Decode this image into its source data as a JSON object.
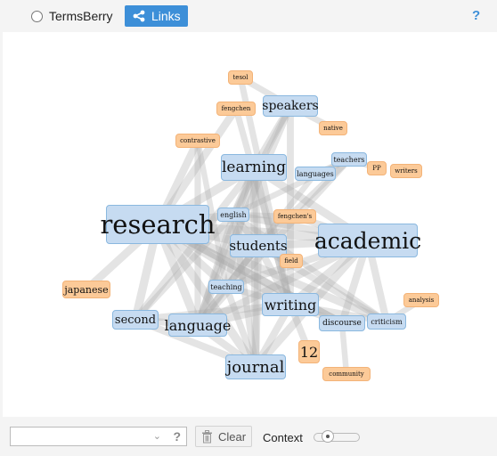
{
  "topbar": {
    "radio_label": "TermsBerry",
    "links_label": "Links",
    "help": "?"
  },
  "graph": {
    "colors": {
      "main_fill": "#c6dbf1",
      "context_fill": "#fcca98",
      "edge": "#aaaaaa"
    },
    "nodes": [
      {
        "id": "research",
        "label": "research",
        "type": "main",
        "weight": 1.0
      },
      {
        "id": "academic",
        "label": "academic",
        "type": "main",
        "weight": 0.8
      },
      {
        "id": "learning",
        "label": "learning",
        "type": "main",
        "weight": 0.55
      },
      {
        "id": "writing",
        "label": "writing",
        "type": "main",
        "weight": 0.5
      },
      {
        "id": "journal",
        "label": "journal",
        "type": "main",
        "weight": 0.55
      },
      {
        "id": "language",
        "label": "language",
        "type": "main",
        "weight": 0.5
      },
      {
        "id": "students",
        "label": "students",
        "type": "main",
        "weight": 0.5
      },
      {
        "id": "speakers",
        "label": "speakers",
        "type": "main",
        "weight": 0.45
      },
      {
        "id": "second",
        "label": "second",
        "type": "main",
        "weight": 0.45
      },
      {
        "id": "discourse",
        "label": "discourse",
        "type": "main",
        "weight": 0.3
      },
      {
        "id": "criticism",
        "label": "criticism",
        "type": "main",
        "weight": 0.25
      },
      {
        "id": "languages",
        "label": "languages",
        "type": "main",
        "weight": 0.25
      },
      {
        "id": "teachers",
        "label": "teachers",
        "type": "main",
        "weight": 0.25
      },
      {
        "id": "teaching",
        "label": "teaching",
        "type": "main",
        "weight": 0.25
      },
      {
        "id": "english",
        "label": "english",
        "type": "main",
        "weight": 0.25
      },
      {
        "id": "tesol",
        "label": "tesol",
        "type": "context",
        "weight": 0.2
      },
      {
        "id": "fengchen",
        "label": "fengchen",
        "type": "context",
        "weight": 0.2
      },
      {
        "id": "native",
        "label": "native",
        "type": "context",
        "weight": 0.2
      },
      {
        "id": "contrastive",
        "label": "contrastive",
        "type": "context",
        "weight": 0.2
      },
      {
        "id": "pp",
        "label": "PP",
        "type": "context",
        "weight": 0.2
      },
      {
        "id": "writers",
        "label": "writers",
        "type": "context",
        "weight": 0.2
      },
      {
        "id": "fengchens",
        "label": "fengchen's",
        "type": "context",
        "weight": 0.2
      },
      {
        "id": "field",
        "label": "field",
        "type": "context",
        "weight": 0.2
      },
      {
        "id": "japanese",
        "label": "japanese",
        "type": "context",
        "weight": 0.3
      },
      {
        "id": "analysis",
        "label": "analysis",
        "type": "context",
        "weight": 0.2
      },
      {
        "id": "twelve",
        "label": "12",
        "type": "context",
        "weight": 0.4
      },
      {
        "id": "community",
        "label": "community",
        "type": "context",
        "weight": 0.2
      }
    ],
    "edges": [
      [
        "research",
        "academic"
      ],
      [
        "research",
        "learning"
      ],
      [
        "research",
        "writing"
      ],
      [
        "research",
        "journal"
      ],
      [
        "research",
        "language"
      ],
      [
        "research",
        "students"
      ],
      [
        "research",
        "second"
      ],
      [
        "research",
        "english"
      ],
      [
        "research",
        "teaching"
      ],
      [
        "research",
        "japanese"
      ],
      [
        "research",
        "contrastive"
      ],
      [
        "research",
        "criticism"
      ],
      [
        "research",
        "discourse"
      ],
      [
        "academic",
        "writing"
      ],
      [
        "academic",
        "journal"
      ],
      [
        "academic",
        "students"
      ],
      [
        "academic",
        "english"
      ],
      [
        "academic",
        "learning"
      ],
      [
        "academic",
        "discourse"
      ],
      [
        "academic",
        "criticism"
      ],
      [
        "academic",
        "language"
      ],
      [
        "academic",
        "teaching"
      ],
      [
        "learning",
        "language"
      ],
      [
        "learning",
        "second"
      ],
      [
        "learning",
        "students"
      ],
      [
        "learning",
        "english"
      ],
      [
        "learning",
        "journal"
      ],
      [
        "learning",
        "teaching"
      ],
      [
        "learning",
        "writing"
      ],
      [
        "speakers",
        "tesol"
      ],
      [
        "speakers",
        "native"
      ],
      [
        "speakers",
        "language"
      ],
      [
        "speakers",
        "english"
      ],
      [
        "speakers",
        "learning"
      ],
      [
        "speakers",
        "writing"
      ],
      [
        "tesol",
        "writing"
      ],
      [
        "fengchen",
        "writing"
      ],
      [
        "fengchen",
        "research"
      ],
      [
        "languages",
        "teachers"
      ],
      [
        "languages",
        "teaching"
      ],
      [
        "teachers",
        "pp"
      ],
      [
        "teachers",
        "language"
      ],
      [
        "teachers",
        "english"
      ],
      [
        "teachers",
        "students"
      ],
      [
        "writing",
        "journal"
      ],
      [
        "writing",
        "discourse"
      ],
      [
        "writing",
        "criticism"
      ],
      [
        "writing",
        "students"
      ],
      [
        "writing",
        "twelve"
      ],
      [
        "writing",
        "second"
      ],
      [
        "writing",
        "language"
      ],
      [
        "writing",
        "teaching"
      ],
      [
        "language",
        "second"
      ],
      [
        "language",
        "journal"
      ],
      [
        "language",
        "english"
      ],
      [
        "language",
        "students"
      ],
      [
        "language",
        "teaching"
      ],
      [
        "second",
        "journal"
      ],
      [
        "second",
        "english"
      ],
      [
        "journal",
        "students"
      ],
      [
        "journal",
        "english"
      ],
      [
        "journal",
        "teaching"
      ],
      [
        "contrastive",
        "language"
      ],
      [
        "contrastive",
        "teaching"
      ],
      [
        "criticism",
        "analysis"
      ],
      [
        "criticism",
        "students"
      ],
      [
        "criticism",
        "english"
      ],
      [
        "discourse",
        "community"
      ],
      [
        "discourse",
        "research"
      ],
      [
        "english",
        "fengchens"
      ],
      [
        "fengchens",
        "academic"
      ],
      [
        "field",
        "students"
      ],
      [
        "students",
        "english"
      ],
      [
        "students",
        "teaching"
      ]
    ]
  },
  "bottom": {
    "combo_value": "",
    "combo_help": "?",
    "clear_label": "Clear",
    "context_label": "Context",
    "context_level": 0.25
  }
}
